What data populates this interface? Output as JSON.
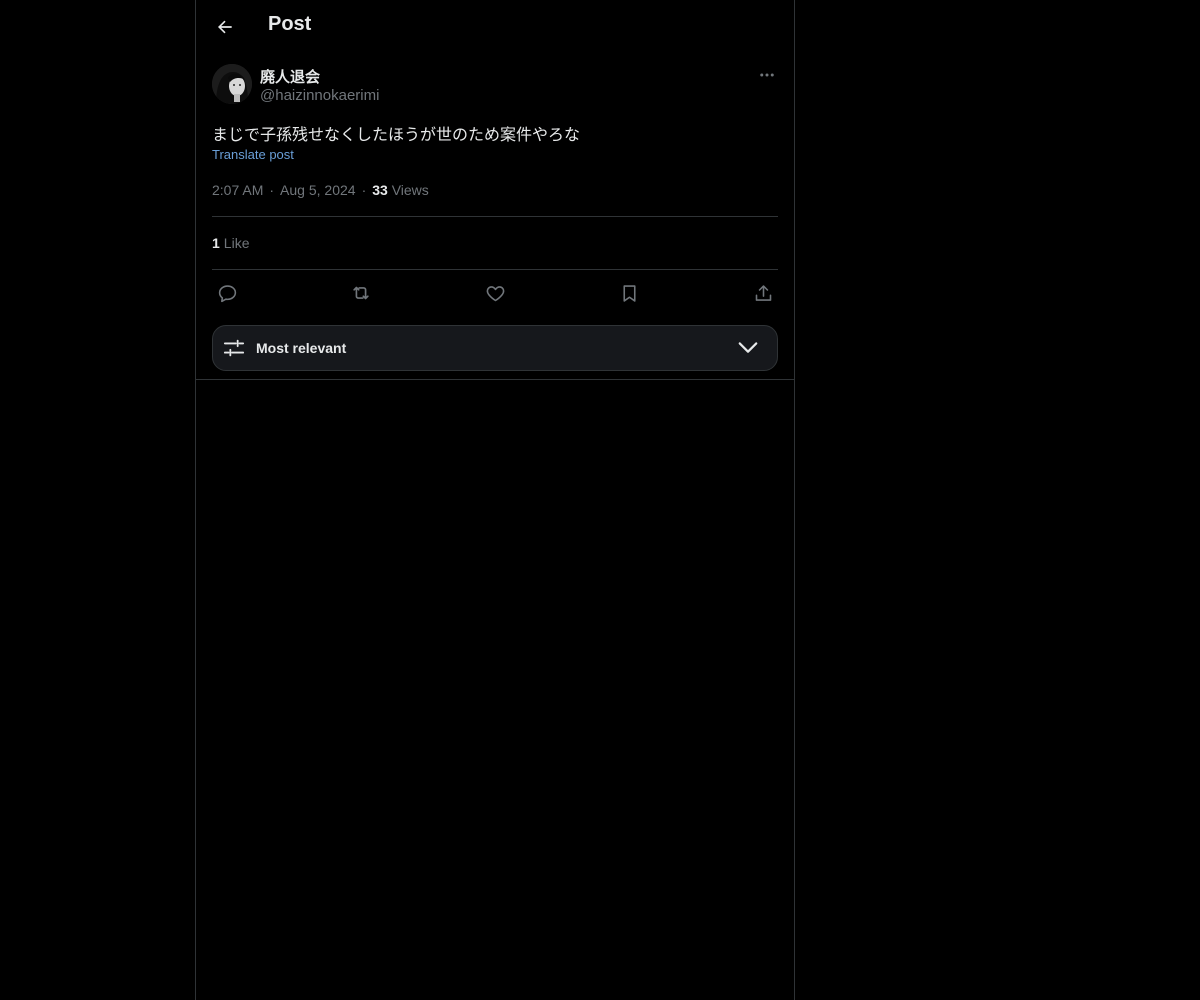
{
  "header": {
    "title": "Post",
    "back_icon": "arrow-left-icon"
  },
  "post": {
    "author": {
      "name": "廃人退会",
      "handle": "@haizinnokaerimi"
    },
    "more_icon": "ellipsis-icon",
    "text": "まじで子孫残せなくしたほうが世のため案件やろな",
    "translate_label": "Translate post",
    "time": "2:07 AM",
    "date": "Aug 5, 2024",
    "separator": "·",
    "views_count": "33",
    "views_label": "Views",
    "likes_count": "1",
    "likes_label": "Like"
  },
  "actions": {
    "icons": [
      "reply-icon",
      "repost-icon",
      "like-icon",
      "bookmark-icon",
      "share-icon"
    ]
  },
  "sort": {
    "label": "Most relevant",
    "icon": "sliders-icon",
    "chevron": "chevron-down-icon"
  },
  "colors": {
    "background": "#000000",
    "text": "#e7e9ea",
    "muted": "#71767b",
    "link": "#6a9fd8",
    "border": "#2f3336"
  }
}
